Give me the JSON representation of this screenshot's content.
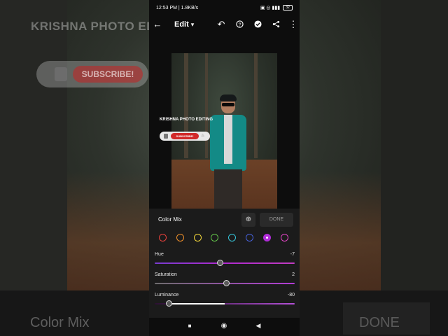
{
  "background": {
    "channel_title": "KRISHNA PHOTO EDITING",
    "subscribe_label": "SUBSCRIBE!",
    "panel_title": "Color Mix",
    "done_label": "DONE"
  },
  "status_bar": {
    "time": "12:53 PM | 1.8KB/s",
    "right_icons": "▣ ◎ ▮▮▮",
    "battery": "32"
  },
  "app_bar": {
    "title": "Edit",
    "icons": [
      "back-arrow-icon",
      "chevron-down-icon",
      "undo-icon",
      "help-icon",
      "check-icon",
      "share-icon",
      "more-vert-icon"
    ]
  },
  "photo_overlay": {
    "title": "KRISHNA PHOTO EDITING",
    "subscribe_label": "SUBSCRIBE!"
  },
  "color_mix": {
    "title": "Color Mix",
    "done_label": "DONE",
    "target_glyph": "⊕",
    "swatches": [
      {
        "color": "#e8413c",
        "selected": false
      },
      {
        "color": "#f0902a",
        "selected": false
      },
      {
        "color": "#f2d63a",
        "selected": false
      },
      {
        "color": "#62c24a",
        "selected": false
      },
      {
        "color": "#36c4d8",
        "selected": false
      },
      {
        "color": "#4660d8",
        "selected": false
      },
      {
        "color": "#b12cd9",
        "selected": true
      },
      {
        "color": "#e044c4",
        "selected": false
      }
    ],
    "sliders": [
      {
        "label": "Hue",
        "value": "-7",
        "fraction": 0.465,
        "track": "linear-gradient(90deg,#7a3cd0,#b02ad0,#c23cc2)"
      },
      {
        "label": "Saturation",
        "value": "2",
        "fraction": 0.51,
        "track": "linear-gradient(90deg,#6d6d6d,#b23bd6)"
      },
      {
        "label": "Luminance",
        "value": "-80",
        "fraction": 0.1,
        "track": "linear-gradient(90deg,#2a1030,#b450d8)"
      }
    ]
  },
  "nav_bar": {
    "recent": "■",
    "home": "◉",
    "back": "◀"
  }
}
